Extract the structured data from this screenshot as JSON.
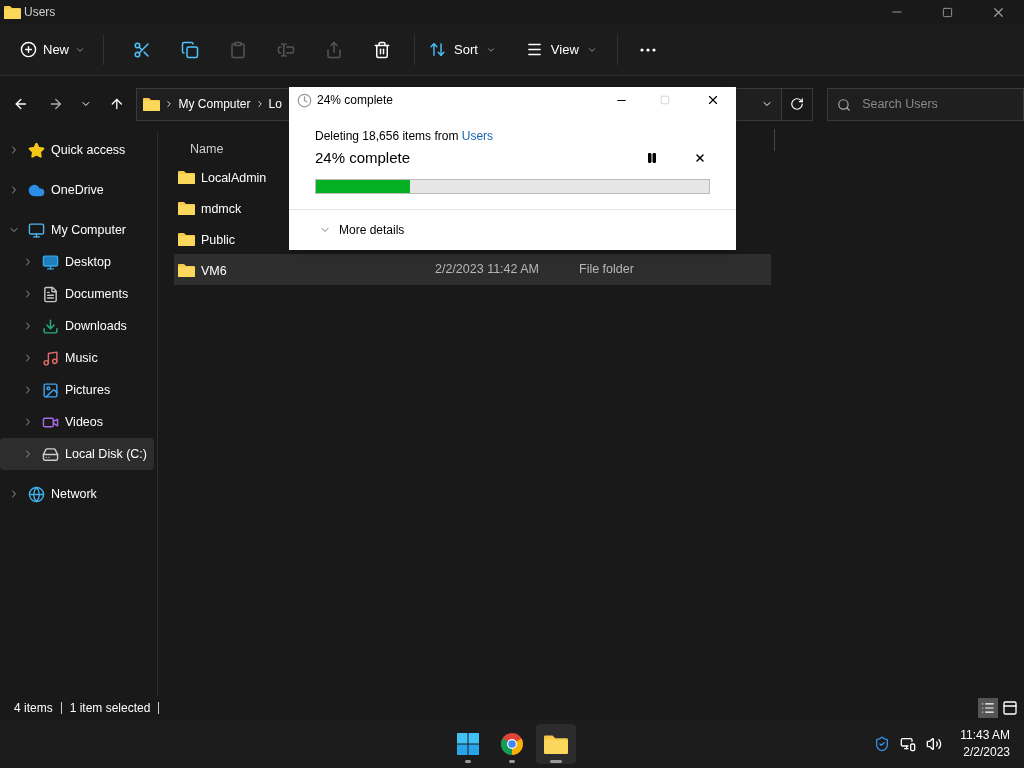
{
  "window": {
    "title": "Users"
  },
  "toolbar": {
    "new_label": "New",
    "sort_label": "Sort",
    "view_label": "View",
    "actions": [
      {
        "kind": "cut",
        "disabled": false
      },
      {
        "kind": "copy",
        "disabled": false
      },
      {
        "kind": "paste",
        "disabled": true
      },
      {
        "kind": "rename",
        "disabled": true
      },
      {
        "kind": "share",
        "disabled": true
      },
      {
        "kind": "delete",
        "disabled": false
      }
    ]
  },
  "address_bar": {
    "crumbs": [
      "My Computer",
      "Lo"
    ]
  },
  "search": {
    "placeholder": "Search Users"
  },
  "sidebar": {
    "items": [
      {
        "label": "Quick access",
        "kind": "star",
        "expanded": false,
        "selected": false
      },
      {
        "label": "OneDrive",
        "kind": "cloud",
        "expanded": false,
        "selected": false
      },
      {
        "label": "My Computer",
        "kind": "computer",
        "expanded": true,
        "selected": false,
        "children": [
          {
            "label": "Desktop",
            "kind": "desktop",
            "expanded": false,
            "selected": false
          },
          {
            "label": "Documents",
            "kind": "document",
            "expanded": false,
            "selected": false
          },
          {
            "label": "Downloads",
            "kind": "download",
            "expanded": false,
            "selected": false
          },
          {
            "label": "Music",
            "kind": "music",
            "expanded": false,
            "selected": false
          },
          {
            "label": "Pictures",
            "kind": "picture",
            "expanded": false,
            "selected": false
          },
          {
            "label": "Videos",
            "kind": "video",
            "expanded": false,
            "selected": false
          },
          {
            "label": "Local Disk (C:)",
            "kind": "disk",
            "expanded": false,
            "selected": true
          }
        ]
      },
      {
        "label": "Network",
        "kind": "network",
        "expanded": false,
        "selected": false
      }
    ]
  },
  "file_list": {
    "columns": [
      "Name"
    ],
    "rows": [
      {
        "name": "LocalAdmin",
        "selected": false
      },
      {
        "name": "mdmck",
        "selected": false
      },
      {
        "name": "Public",
        "selected": false
      },
      {
        "name": "VM6",
        "date": "2/2/2023 11:42 AM",
        "type": "File folder",
        "selected": true
      }
    ]
  },
  "status_bar": {
    "item_count": "4 items",
    "selection": "1 item selected"
  },
  "dialog": {
    "title": "24% complete",
    "message": "Deleting 18,656 items from ",
    "source_link": "Users",
    "heading": "24% complete",
    "level": 0.24,
    "more_details": {
      "label": "More details",
      "expanded": false
    }
  },
  "taskbar": {
    "apps": [
      {
        "kind": "start",
        "active": false
      },
      {
        "kind": "chrome",
        "active": false
      },
      {
        "kind": "explorer",
        "active": true
      }
    ],
    "time": "11:43 AM",
    "date": "2/2/2023"
  }
}
